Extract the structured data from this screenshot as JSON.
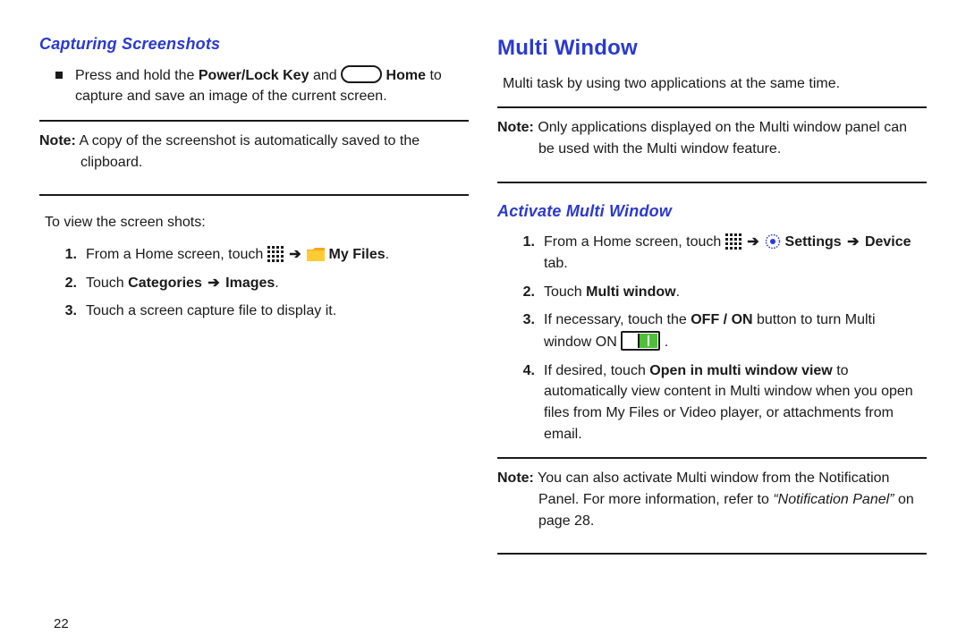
{
  "page_number": "22",
  "arrow_glyph": "➔",
  "left": {
    "h2": "Capturing Screenshots",
    "bullet": {
      "pre": "Press and hold the ",
      "b1": "Power/Lock Key",
      "mid": " and ",
      "b2": " Home",
      "post": " to capture and save an image of the current screen."
    },
    "note": {
      "label": "Note:",
      "text": " A copy of the screenshot is automatically saved to the clipboard."
    },
    "lead_in": "To view the screen shots:",
    "steps": [
      {
        "n": "1.",
        "pre": "From a Home screen, touch ",
        "b1": " My Files",
        "post": "."
      },
      {
        "n": "2.",
        "pre": "Touch ",
        "b1": "Categories",
        "mid": " ",
        "b2": " Images",
        "post": "."
      },
      {
        "n": "3.",
        "pre": "Touch a screen capture file to display it.",
        "b1": "",
        "post": ""
      }
    ]
  },
  "right": {
    "h1": "Multi Window",
    "intro": "Multi task by using two applications at the same time.",
    "note1": {
      "label": "Note:",
      "text": " Only applications displayed on the Multi window panel can be used with the Multi window feature."
    },
    "h2": "Activate Multi Window",
    "steps": [
      {
        "n": "1.",
        "pre": "From a Home screen, touch ",
        "mid": " ",
        "b1": " Settings",
        "mid2": " ",
        "b2": "Device",
        "tab": " tab",
        "post": "."
      },
      {
        "n": "2.",
        "pre": "Touch ",
        "b1": "Multi window",
        "post": "."
      },
      {
        "n": "3.",
        "pre": "If necessary, touch the ",
        "b1": "OFF / ON",
        "mid": " button to turn Multi window ON ",
        "post": "."
      },
      {
        "n": "4.",
        "pre": "If desired, touch ",
        "b1": "Open in multi window view",
        "mid": " to automatically view content in Multi window when you open files from My Files or Video player, or attachments from email.",
        "post": ""
      }
    ],
    "note2": {
      "label": "Note:",
      "text1": " You can also activate Multi window from the Notification Panel. For more information, refer to ",
      "ref": "“Notification Panel”",
      "text2": " on page 28."
    }
  }
}
